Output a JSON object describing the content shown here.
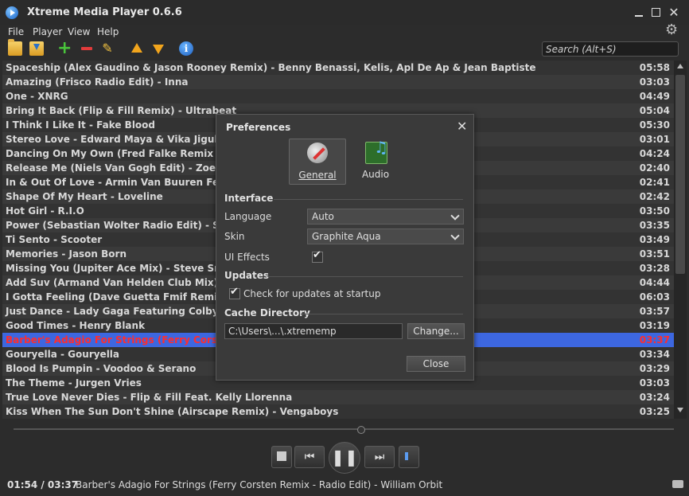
{
  "window": {
    "title": "Xtreme Media Player 0.6.6"
  },
  "menu": [
    "File",
    "Player",
    "View",
    "Help"
  ],
  "search": {
    "placeholder": "Search  (Alt+S)"
  },
  "playlist": [
    {
      "title": "Spaceship (Alex Gaudino & Jason Rooney Remix) - Benny Benassi, Kelis, Apl De Ap & Jean Baptiste",
      "duration": "05:58"
    },
    {
      "title": "Amazing (Frisco Radio Edit) - Inna",
      "duration": "03:03"
    },
    {
      "title": "One - XNRG",
      "duration": "04:49"
    },
    {
      "title": "Bring It Back (Flip & Fill Remix) - Ultrabeat",
      "duration": "05:04"
    },
    {
      "title": "I Think I Like It - Fake Blood",
      "duration": "05:30"
    },
    {
      "title": "Stereo Love - Edward Maya & Vika Jigulina",
      "duration": "03:01"
    },
    {
      "title": "Dancing On My Own (Fred Falke Remix Edit) - R",
      "duration": "04:24"
    },
    {
      "title": "Release Me (Niels Van Gogh Edit) - Zoe Badwi",
      "duration": "02:40"
    },
    {
      "title": "In & Out Of Love - Armin Van Buuren Feat. Shar",
      "duration": "02:41"
    },
    {
      "title": "Shape Of My Heart - Loveline",
      "duration": "02:42"
    },
    {
      "title": "Hot Girl - R.I.O",
      "duration": "03:50"
    },
    {
      "title": "Power (Sebastian Wolter Radio Edit) - Shaun Ba",
      "duration": "03:35"
    },
    {
      "title": "Ti Sento - Scooter",
      "duration": "03:49"
    },
    {
      "title": "Memories - Jason Born",
      "duration": "03:51"
    },
    {
      "title": "Missing You (Jupiter Ace Mix) - Steve Smart V S",
      "duration": "03:28"
    },
    {
      "title": "Add Suv (Armand Van Helden Club Mix) - Uffie",
      "duration": "04:44"
    },
    {
      "title": "I Gotta Feeling (Dave Guetta Fmif Remix) - Blac",
      "duration": "06:03"
    },
    {
      "title": "Just Dance - Lady Gaga Featuring Colby O'Donis",
      "duration": "03:57"
    },
    {
      "title": "Good Times - Henry Blank",
      "duration": "03:19"
    },
    {
      "title": "Barber's Adagio For Strings (Ferry Corsten Remi",
      "duration": "03:37",
      "active": true
    },
    {
      "title": "Gouryella - Gouryella",
      "duration": "03:34"
    },
    {
      "title": "Blood Is Pumpin - Voodoo & Serano",
      "duration": "03:29"
    },
    {
      "title": "The Theme - Jurgen Vries",
      "duration": "03:03"
    },
    {
      "title": "True Love Never Dies - Flip & Fill Feat. Kelly Llorenna",
      "duration": "03:24"
    },
    {
      "title": "Kiss When The Sun Don't Shine (Airscape Remix) - Vengaboys",
      "duration": "03:25"
    }
  ],
  "status": {
    "time": "01:54 / 03:37",
    "track": "Barber's Adagio For Strings (Ferry Corsten Remix - Radio Edit) - William Orbit"
  },
  "preferences": {
    "title": "Preferences",
    "tabs": {
      "general": "General",
      "audio": "Audio"
    },
    "interface_heading": "Interface",
    "language_label": "Language",
    "language_value": "Auto",
    "skin_label": "Skin",
    "skin_value": "Graphite Aqua",
    "ui_effects_label": "UI Effects",
    "updates_heading": "Updates",
    "check_updates_label": "Check for updates at startup",
    "cache_heading": "Cache Directory",
    "cache_path": "C:\\Users\\...\\.xtrememp",
    "change_button": "Change...",
    "close_button": "Close"
  }
}
